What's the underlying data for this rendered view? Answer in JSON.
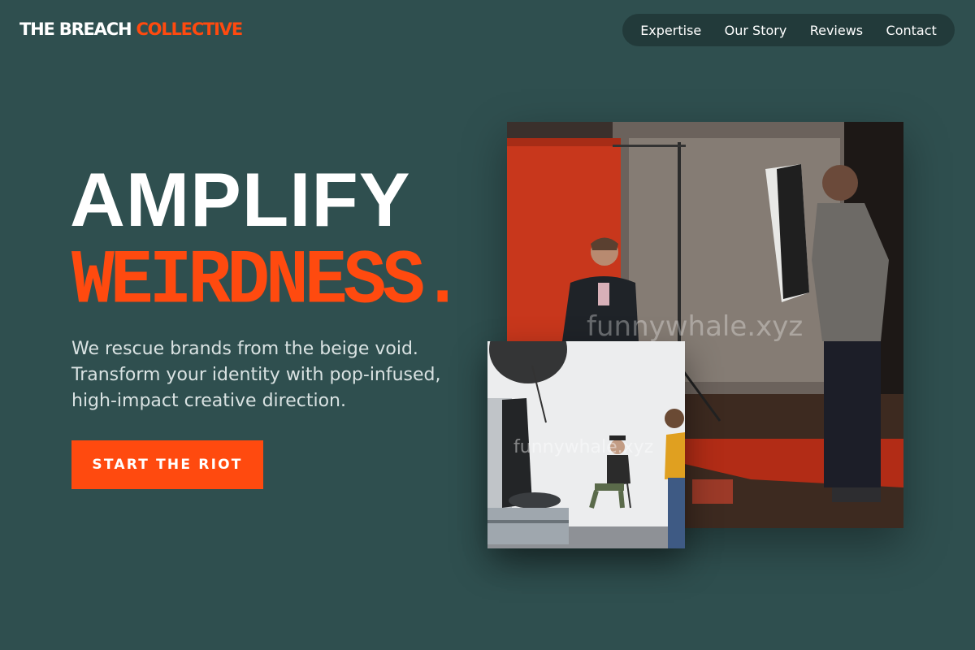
{
  "brand": {
    "part1": "THE BREACH",
    "part2": "COLLECTIVE"
  },
  "nav": {
    "items": [
      {
        "label": "Expertise"
      },
      {
        "label": "Our Story"
      },
      {
        "label": "Reviews"
      },
      {
        "label": "Contact"
      }
    ]
  },
  "hero": {
    "line1": "AMPLIFY",
    "line2": "WEIRDNESS.",
    "description": "We rescue brands from the beige void. Transform your identity with pop-infused, high-impact creative direction.",
    "cta_label": "START THE RIOT"
  },
  "watermark": "funnywhale.xyz",
  "colors": {
    "background": "#2f4f4f",
    "accent": "#ff4a0f",
    "nav_bg": "#223a3a",
    "text": "#ffffff"
  }
}
